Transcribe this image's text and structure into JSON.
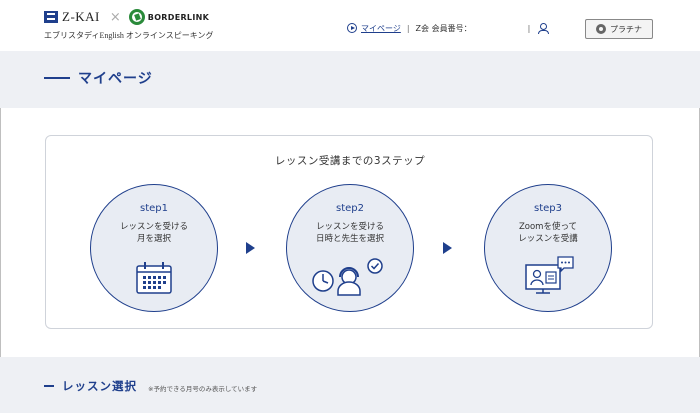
{
  "header": {
    "brand_zkai": "Z-KAI",
    "brand_times": "×",
    "brand_borderlink": "BORDERLINK",
    "subtitle": "エブリスタディEnglish オンラインスピーキング",
    "mypage_link": "マイページ",
    "separator": "|",
    "member_label": "Z会 会員番号：",
    "member_number": "",
    "plan_badge": "プラチナ"
  },
  "page": {
    "title": "マイページ"
  },
  "steps_card": {
    "title": "レッスン受講までの3ステップ",
    "steps": [
      {
        "name": "step1",
        "line1": "レッスンを受ける",
        "line2": "月を選択",
        "icon": "calendar-icon"
      },
      {
        "name": "step2",
        "line1": "レッスンを受ける",
        "line2": "日時と先生を選択",
        "icon": "clock-teacher-icon"
      },
      {
        "name": "step3",
        "line1": "Zoomを使って",
        "line2": "レッスンを受講",
        "icon": "video-lesson-icon"
      }
    ]
  },
  "lesson_select": {
    "title": "レッスン選択",
    "note": "※予約できる月号のみ表示しています"
  },
  "colors": {
    "primary": "#1f3f8c",
    "band": "#eef0f4",
    "circle_fill": "#e8ecf3",
    "brand_green": "#2a8a3a"
  }
}
